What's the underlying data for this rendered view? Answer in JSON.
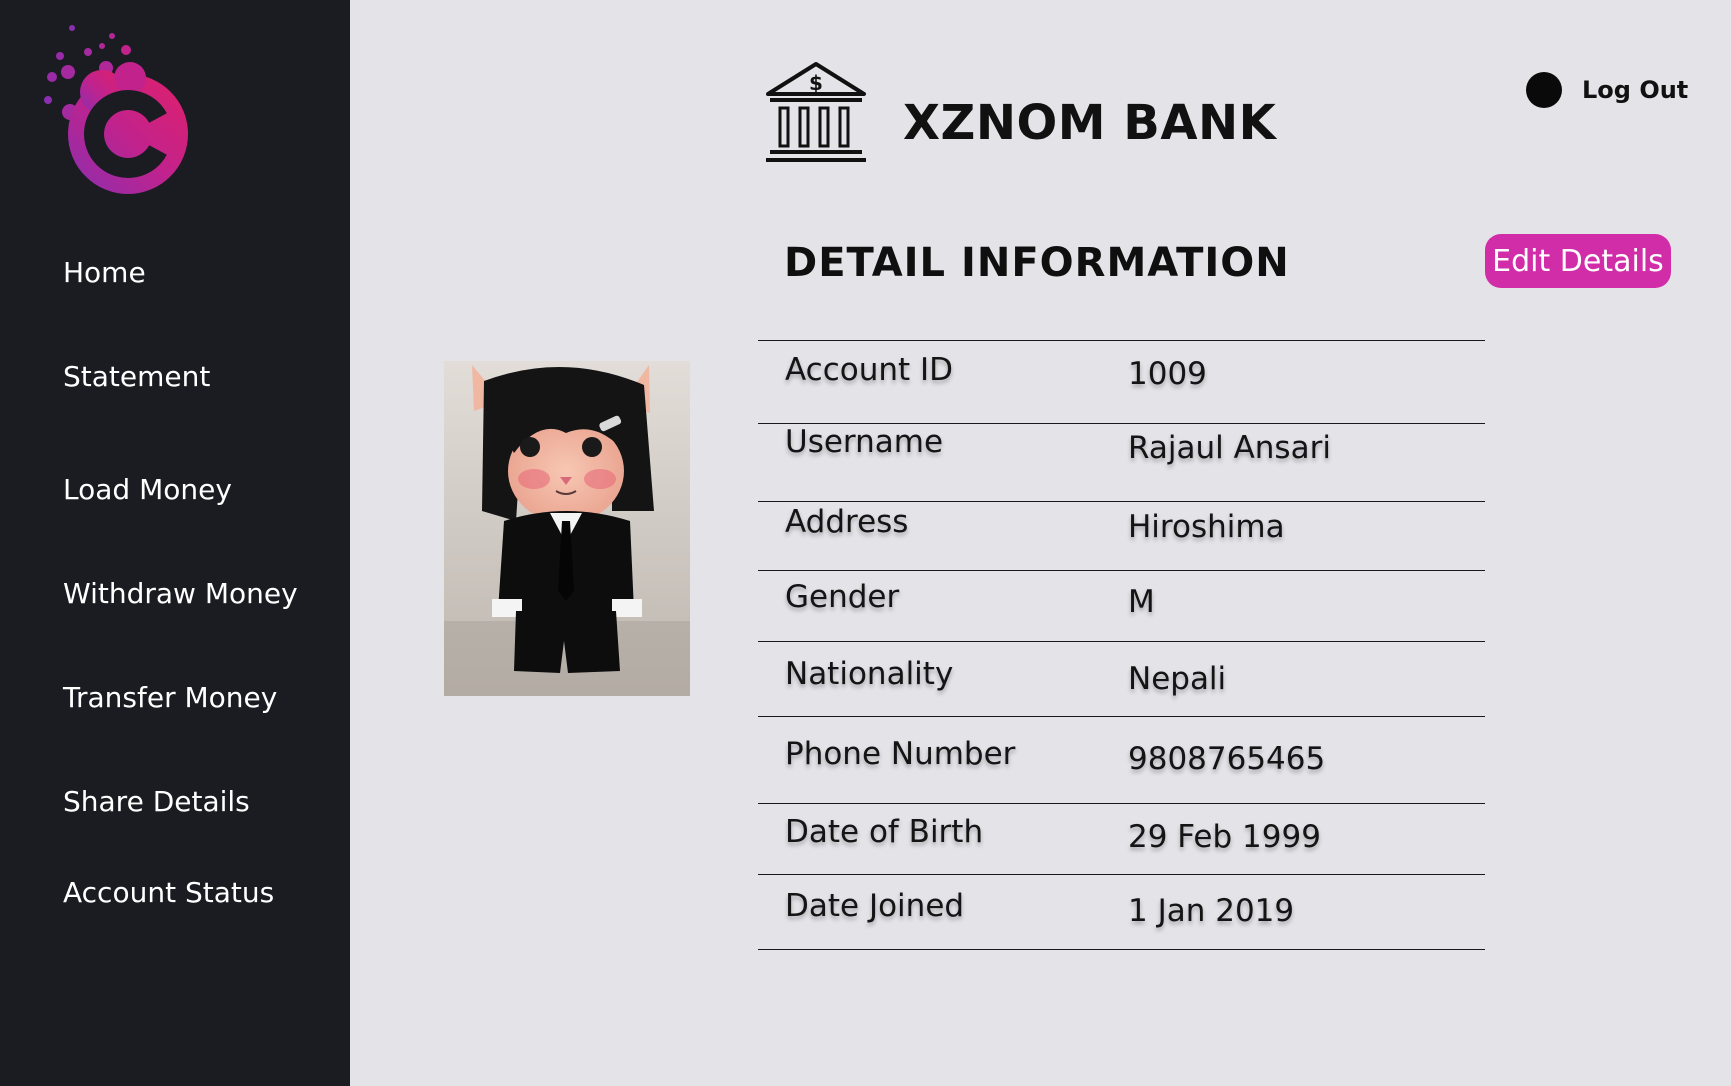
{
  "sidebar": {
    "logo_icon": "c-splash-logo-icon",
    "logo_colors": [
      "#c2228c",
      "#e0206a",
      "#8a2fb0"
    ],
    "items": [
      {
        "label": "Home"
      },
      {
        "label": "Statement"
      },
      {
        "label": "Load Money"
      },
      {
        "label": "Withdraw Money"
      },
      {
        "label": "Transfer Money"
      },
      {
        "label": "Share Details"
      },
      {
        "label": "Account Status"
      }
    ]
  },
  "header": {
    "bank_icon": "bank-building-icon",
    "bank_name": "XZNOM BANK",
    "logout_label": "Log Out"
  },
  "detail": {
    "title": "DETAIL INFORMATION",
    "edit_label": "Edit Details",
    "accent_color": "#d12da8",
    "rows": [
      {
        "label": "Account ID",
        "value": "1009"
      },
      {
        "label": "Username",
        "value": "Rajaul Ansari"
      },
      {
        "label": "Address",
        "value": "Hiroshima"
      },
      {
        "label": "Gender",
        "value": "M"
      },
      {
        "label": "Nationality",
        "value": "Nepali"
      },
      {
        "label": "Phone Number",
        "value": "9808765465"
      },
      {
        "label": "Date of Birth",
        "value": "29 Feb 1999"
      },
      {
        "label": "Date Joined",
        "value": "1 Jan 2019"
      }
    ]
  },
  "avatar": {
    "icon": "profile-photo-cat-in-suit"
  }
}
